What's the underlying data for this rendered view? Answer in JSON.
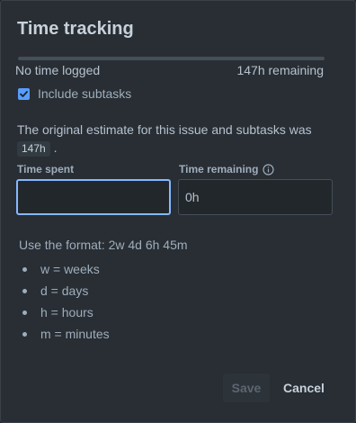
{
  "dialog": {
    "title": "Time tracking"
  },
  "progress": {
    "logged_label": "No time logged",
    "remaining_label": "147h remaining",
    "logged_fraction": 0
  },
  "include_subtasks": {
    "label": "Include subtasks",
    "checked": true
  },
  "estimate": {
    "text": "The original estimate for this issue and subtasks was",
    "value": "147h",
    "suffix": "."
  },
  "time_spent": {
    "label": "Time spent",
    "value": ""
  },
  "time_remaining": {
    "label": "Time remaining",
    "value": "0h"
  },
  "format_help": {
    "hint": "Use the format: 2w 4d 6h 45m",
    "units": [
      "w = weeks",
      "d = days",
      "h = hours",
      "m = minutes"
    ]
  },
  "actions": {
    "save_label": "Save",
    "cancel_label": "Cancel"
  },
  "colors": {
    "accent": "#579dff",
    "focus": "#85b8ff",
    "surface": "#282e33"
  },
  "icons": {
    "checkbox": "checkmark-icon",
    "info": "info-icon"
  }
}
